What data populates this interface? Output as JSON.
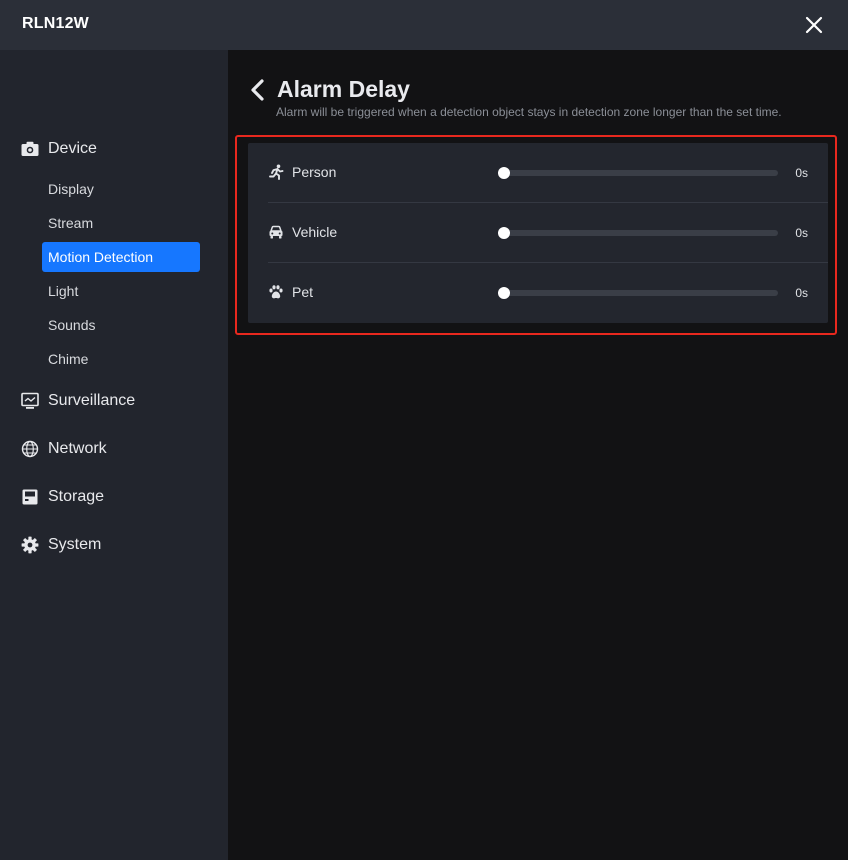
{
  "window": {
    "title": "RLN12W"
  },
  "sidebar": {
    "groups": [
      {
        "label": "Device",
        "icon": "camera-icon"
      },
      {
        "label": "Surveillance",
        "icon": "monitor-icon"
      },
      {
        "label": "Network",
        "icon": "globe-icon"
      },
      {
        "label": "Storage",
        "icon": "disk-icon"
      },
      {
        "label": "System",
        "icon": "gear-icon"
      }
    ],
    "device_items": [
      {
        "label": "Display"
      },
      {
        "label": "Stream"
      },
      {
        "label": "Motion Detection",
        "active": true
      },
      {
        "label": "Light"
      },
      {
        "label": "Sounds"
      },
      {
        "label": "Chime"
      }
    ]
  },
  "page": {
    "title": "Alarm Delay",
    "description": "Alarm will be triggered when a detection object stays in detection zone longer than the set time."
  },
  "delays": [
    {
      "label": "Person",
      "icon": "running-person-icon",
      "value_text": "0s",
      "level": 0
    },
    {
      "label": "Vehicle",
      "icon": "car-icon",
      "value_text": "0s",
      "level": 0
    },
    {
      "label": "Pet",
      "icon": "paw-icon",
      "value_text": "0s",
      "level": 0
    }
  ],
  "colors": {
    "accent": "#1677ff",
    "highlight": "#e8281e",
    "sidebar_bg": "#22252d",
    "main_bg": "#121214"
  }
}
